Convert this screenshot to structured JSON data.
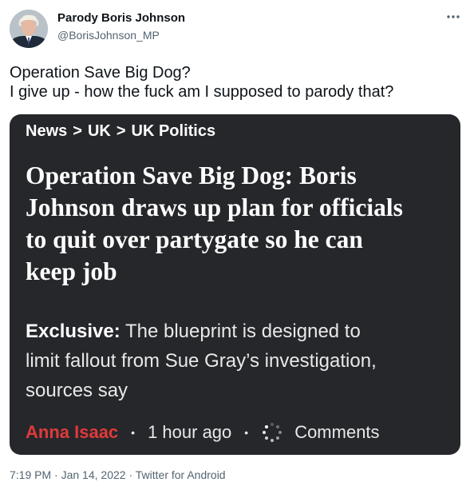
{
  "author": {
    "name": "Parody Boris Johnson",
    "handle": "@BorisJohnson_MP"
  },
  "tweet": {
    "lines": [
      "Operation Save Big Dog?",
      "I give up - how the fuck am I supposed to parody that?"
    ]
  },
  "card": {
    "breadcrumb": [
      "News",
      "UK",
      "UK Politics"
    ],
    "breadcrumb_separator": ">",
    "headline_lines": [
      "Operation Save Big Dog: Boris",
      "Johnson draws up plan for officials",
      "to quit over partygate so he can",
      "keep job"
    ],
    "standfirst_label": "Exclusive:",
    "standfirst_lines": [
      "The blueprint is designed to",
      "limit fallout from Sue Gray’s investigation,",
      "sources say"
    ],
    "byline": "Anna Isaac",
    "time": "1 hour ago",
    "bullet": "•",
    "comments_label": "Comments",
    "colors": {
      "background": "#26272b",
      "byline": "#e03a3a",
      "text": "#ffffff"
    }
  },
  "footer": {
    "time": "7:19 PM",
    "separator": "·",
    "date": "Jan 14, 2022",
    "source": "Twitter for Android"
  },
  "icons": {
    "more": "more-horizontal-icon",
    "comments": "loading-spinner-icon"
  }
}
